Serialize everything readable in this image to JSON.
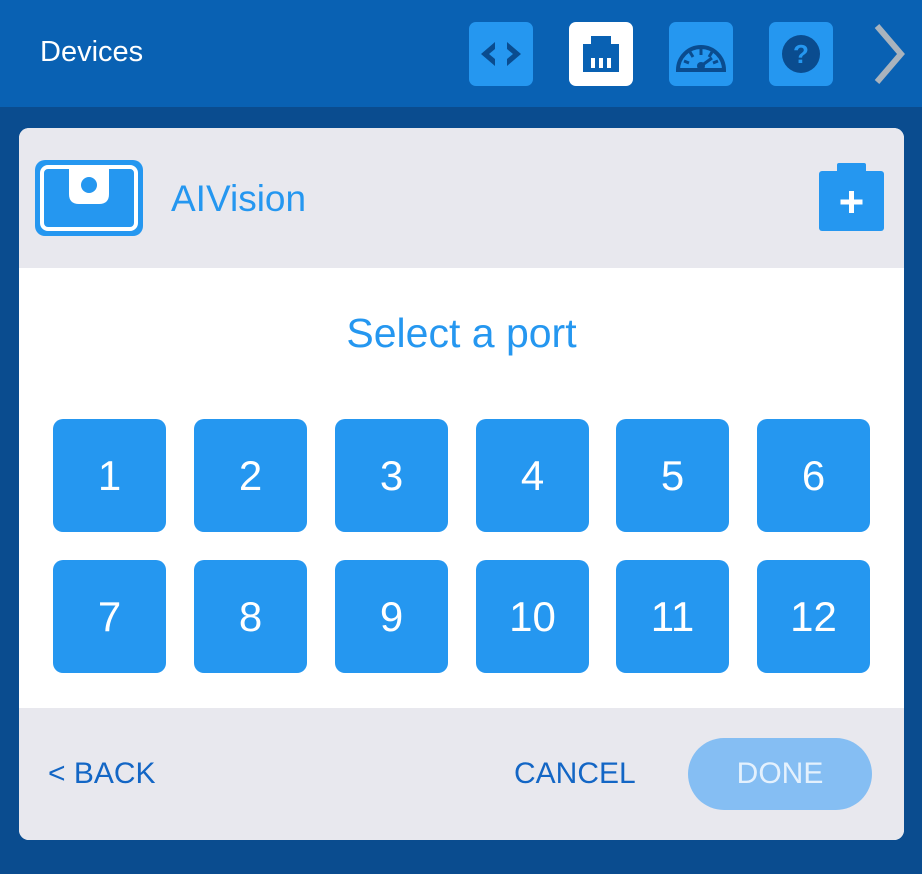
{
  "header": {
    "title": "Devices",
    "tools": [
      {
        "name": "code-icon",
        "active": false
      },
      {
        "name": "ports-icon",
        "active": true
      },
      {
        "name": "dashboard-icon",
        "active": false
      },
      {
        "name": "help-icon",
        "active": false
      }
    ]
  },
  "panel": {
    "device_name": "AIVision",
    "prompt": "Select a port",
    "ports": [
      "1",
      "2",
      "3",
      "4",
      "5",
      "6",
      "7",
      "8",
      "9",
      "10",
      "11",
      "12"
    ]
  },
  "footer": {
    "back_label": "< BACK",
    "cancel_label": "CANCEL",
    "done_label": "DONE"
  },
  "colors": {
    "background": "#0a4c8f",
    "topbar": "#0961b3",
    "accent": "#2597f0",
    "panel_header": "#e8e8ee",
    "link": "#1366c5",
    "done_disabled": "#85bef3"
  }
}
